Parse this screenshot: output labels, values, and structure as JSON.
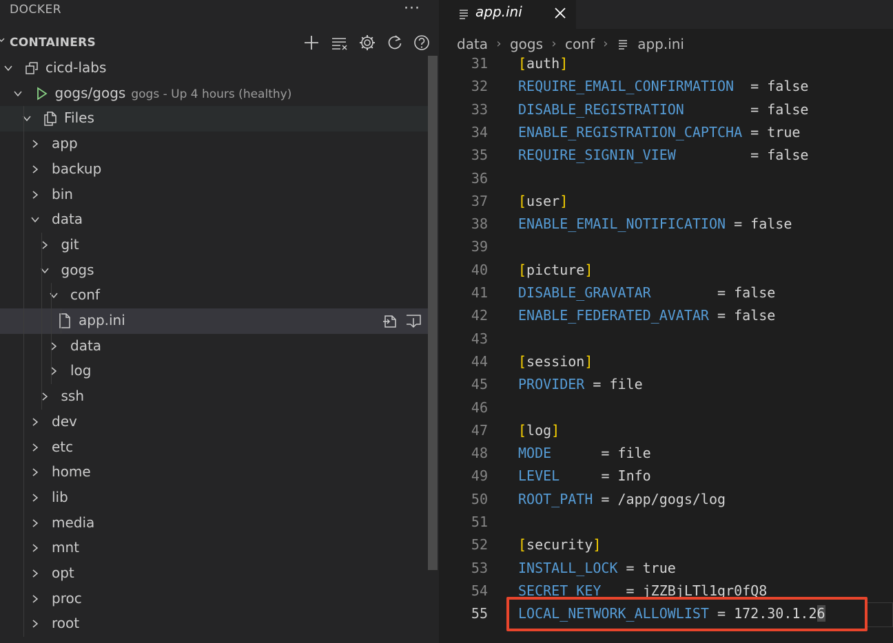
{
  "sidebar": {
    "title": "DOCKER",
    "more_glyph": "···",
    "section_title": "CONTAINERS",
    "toolbar_icons": [
      "plus-icon",
      "filter-list-icon",
      "gear-icon",
      "refresh-icon",
      "help-icon"
    ],
    "tree": [
      {
        "label": "cicd-labs",
        "depth": 0,
        "chevron": "down",
        "icon": "group-icon"
      },
      {
        "label": "gogs/gogs",
        "desc": "gogs - Up 4 hours (healthy)",
        "depth": 1,
        "chevron": "down",
        "icon": "play-icon"
      },
      {
        "label": "Files",
        "depth": 2,
        "chevron": "down",
        "icon": "files-icon",
        "hover": true
      },
      {
        "label": "app",
        "depth": 3,
        "chevron": "right"
      },
      {
        "label": "backup",
        "depth": 3,
        "chevron": "right"
      },
      {
        "label": "bin",
        "depth": 3,
        "chevron": "right"
      },
      {
        "label": "data",
        "depth": 3,
        "chevron": "down"
      },
      {
        "label": "git",
        "depth": 4,
        "chevron": "right"
      },
      {
        "label": "gogs",
        "depth": 4,
        "chevron": "down"
      },
      {
        "label": "conf",
        "depth": 5,
        "chevron": "down"
      },
      {
        "label": "app.ini",
        "depth": 6,
        "chevron": "none",
        "icon": "file-icon",
        "selected": true
      },
      {
        "label": "data",
        "depth": 5,
        "chevron": "right"
      },
      {
        "label": "log",
        "depth": 5,
        "chevron": "right"
      },
      {
        "label": "ssh",
        "depth": 4,
        "chevron": "right"
      },
      {
        "label": "dev",
        "depth": 3,
        "chevron": "right"
      },
      {
        "label": "etc",
        "depth": 3,
        "chevron": "right"
      },
      {
        "label": "home",
        "depth": 3,
        "chevron": "right"
      },
      {
        "label": "lib",
        "depth": 3,
        "chevron": "right"
      },
      {
        "label": "media",
        "depth": 3,
        "chevron": "right"
      },
      {
        "label": "mnt",
        "depth": 3,
        "chevron": "right"
      },
      {
        "label": "opt",
        "depth": 3,
        "chevron": "right"
      },
      {
        "label": "proc",
        "depth": 3,
        "chevron": "right"
      },
      {
        "label": "root",
        "depth": 3,
        "chevron": "right"
      }
    ]
  },
  "editor": {
    "tab": {
      "label": "app.ini"
    },
    "breadcrumb": [
      "data",
      "gogs",
      "conf",
      "app.ini"
    ],
    "lines": [
      {
        "n": "31",
        "section": "auth"
      },
      {
        "n": "32",
        "key": "REQUIRE_EMAIL_CONFIRMATION",
        "pad": "  ",
        "value": "false"
      },
      {
        "n": "33",
        "key": "DISABLE_REGISTRATION",
        "pad": "        ",
        "value": "false"
      },
      {
        "n": "34",
        "key": "ENABLE_REGISTRATION_CAPTCHA",
        "pad": " ",
        "value": "true"
      },
      {
        "n": "35",
        "key": "REQUIRE_SIGNIN_VIEW",
        "pad": "         ",
        "value": "false"
      },
      {
        "n": "36"
      },
      {
        "n": "37",
        "section": "user"
      },
      {
        "n": "38",
        "key": "ENABLE_EMAIL_NOTIFICATION",
        "pad": " ",
        "value": "false"
      },
      {
        "n": "39"
      },
      {
        "n": "40",
        "section": "picture"
      },
      {
        "n": "41",
        "key": "DISABLE_GRAVATAR",
        "pad": "        ",
        "value": "false"
      },
      {
        "n": "42",
        "key": "ENABLE_FEDERATED_AVATAR",
        "pad": " ",
        "value": "false"
      },
      {
        "n": "43"
      },
      {
        "n": "44",
        "section": "session"
      },
      {
        "n": "45",
        "key": "PROVIDER",
        "pad": " ",
        "value": "file"
      },
      {
        "n": "46"
      },
      {
        "n": "47",
        "section": "log"
      },
      {
        "n": "48",
        "key": "MODE",
        "pad": "      ",
        "value": "file"
      },
      {
        "n": "49",
        "key": "LEVEL",
        "pad": "     ",
        "value": "Info"
      },
      {
        "n": "50",
        "key": "ROOT_PATH",
        "pad": " ",
        "value": "/app/gogs/log"
      },
      {
        "n": "51"
      },
      {
        "n": "52",
        "section": "security"
      },
      {
        "n": "53",
        "key": "INSTALL_LOCK",
        "pad": " ",
        "value": "true"
      },
      {
        "n": "54",
        "key": "SECRET_KEY",
        "pad": "   ",
        "value": "jZZBjLTl1gr0fQ8"
      },
      {
        "n": "55",
        "key": "LOCAL_NETWORK_ALLOWLIST",
        "pad": " ",
        "value": "172.30.1.2",
        "cursor_value": "6",
        "current": true
      }
    ]
  },
  "colors": {
    "highlight_box": "#e8452c",
    "key": "#569cd6",
    "bracket": "#ffd700"
  }
}
